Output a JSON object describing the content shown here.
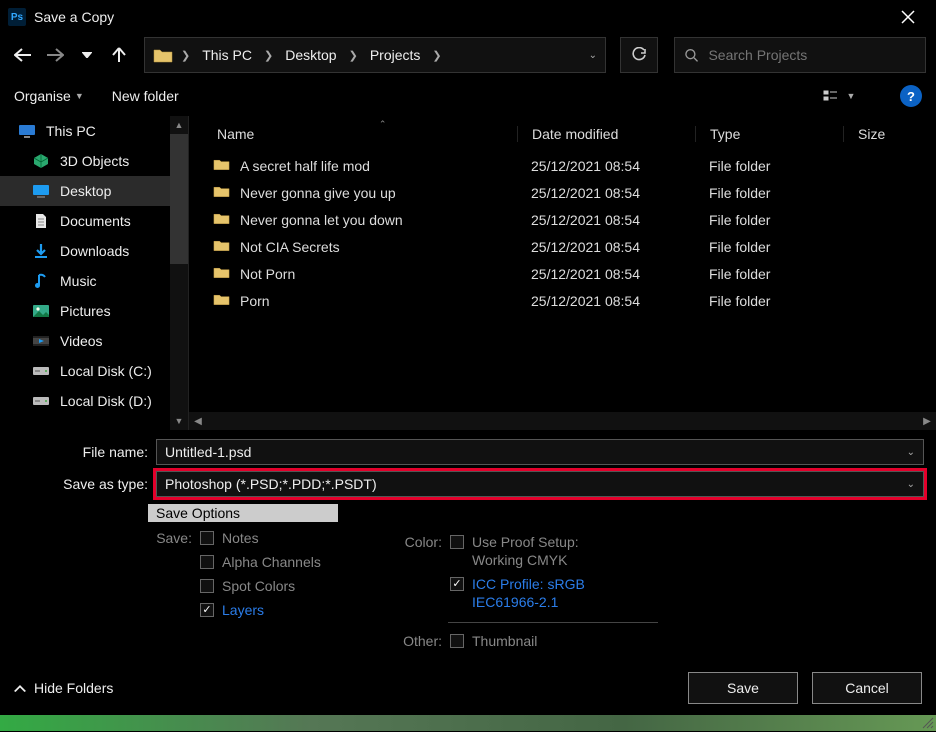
{
  "window": {
    "title": "Save a Copy"
  },
  "breadcrumb": {
    "items": [
      "This PC",
      "Desktop",
      "Projects"
    ]
  },
  "search": {
    "placeholder": "Search Projects"
  },
  "toolbar": {
    "organise": "Organise",
    "newfolder": "New folder"
  },
  "columns": {
    "name": "Name",
    "date": "Date modified",
    "type": "Type",
    "size": "Size"
  },
  "sidebar": {
    "items": [
      {
        "label": "This PC",
        "icon": "monitor"
      },
      {
        "label": "3D Objects",
        "icon": "cube"
      },
      {
        "label": "Desktop",
        "icon": "desktop",
        "active": true
      },
      {
        "label": "Documents",
        "icon": "doc"
      },
      {
        "label": "Downloads",
        "icon": "download"
      },
      {
        "label": "Music",
        "icon": "music"
      },
      {
        "label": "Pictures",
        "icon": "pictures"
      },
      {
        "label": "Videos",
        "icon": "videos"
      },
      {
        "label": "Local Disk (C:)",
        "icon": "disk"
      },
      {
        "label": "Local Disk (D:)",
        "icon": "disk"
      }
    ]
  },
  "files": [
    {
      "name": "A secret half life mod",
      "date": "25/12/2021 08:54",
      "type": "File folder"
    },
    {
      "name": "Never gonna give you up",
      "date": "25/12/2021 08:54",
      "type": "File folder"
    },
    {
      "name": "Never gonna let you down",
      "date": "25/12/2021 08:54",
      "type": "File folder"
    },
    {
      "name": "Not CIA Secrets",
      "date": "25/12/2021 08:54",
      "type": "File folder"
    },
    {
      "name": "Not Porn",
      "date": "25/12/2021 08:54",
      "type": "File folder"
    },
    {
      "name": "Porn",
      "date": "25/12/2021 08:54",
      "type": "File folder"
    }
  ],
  "fields": {
    "filename_label": "File name:",
    "filename_value": "Untitled-1.psd",
    "saveas_label": "Save as type:",
    "saveas_value": "Photoshop (*.PSD;*.PDD;*.PSDT)"
  },
  "options": {
    "header": "Save Options",
    "save_label": "Save:",
    "notes": "Notes",
    "alpha": "Alpha Channels",
    "spot": "Spot Colors",
    "layers": "Layers",
    "color_label": "Color:",
    "proof": "Use Proof Setup:",
    "proof2": "Working CMYK",
    "icc": "ICC Profile:  sRGB",
    "icc2": "IEC61966-2.1",
    "other_label": "Other:",
    "thumbnail": "Thumbnail"
  },
  "footer": {
    "hide": "Hide Folders",
    "save": "Save",
    "cancel": "Cancel"
  },
  "help": {
    "label": "?"
  }
}
